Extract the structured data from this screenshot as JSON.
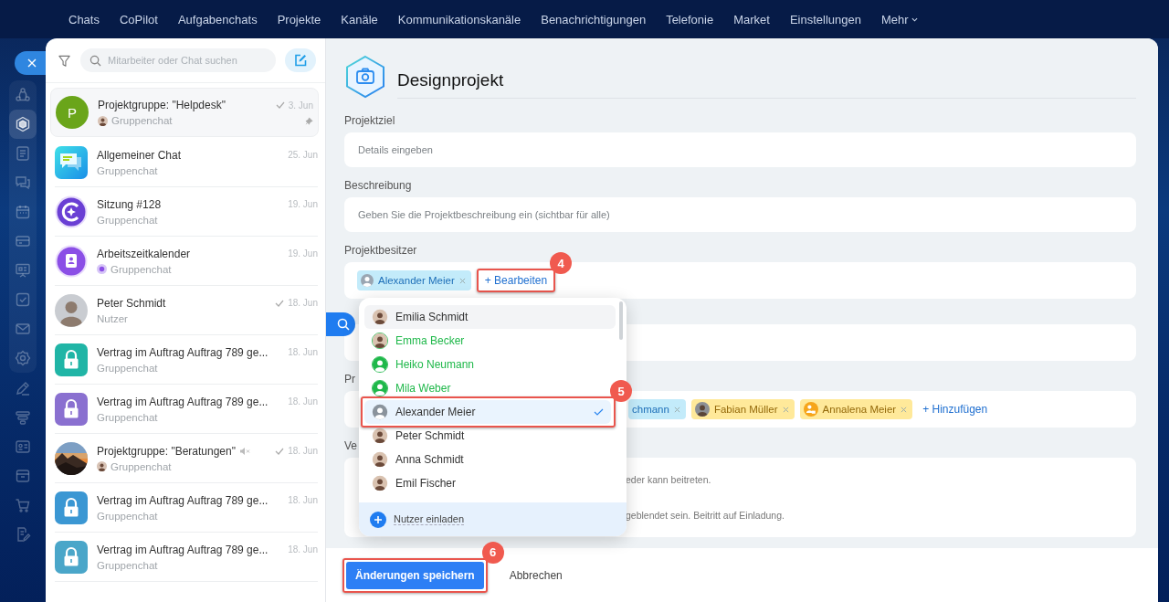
{
  "top_nav": [
    {
      "label": "Chats",
      "menu": false
    },
    {
      "label": "CoPilot",
      "menu": false
    },
    {
      "label": "Aufgabenchats",
      "menu": false
    },
    {
      "label": "Projekte",
      "menu": false
    },
    {
      "label": "Kanäle",
      "menu": false
    },
    {
      "label": "Kommunikationskanäle",
      "menu": false
    },
    {
      "label": "Benachrichtigungen",
      "menu": false
    },
    {
      "label": "Telefonie",
      "menu": false
    },
    {
      "label": "Market",
      "menu": false
    },
    {
      "label": "Einstellungen",
      "menu": false
    },
    {
      "label": "Mehr",
      "menu": true
    }
  ],
  "rail": {
    "pinned": [
      {
        "selected": false
      },
      {
        "selected": true
      },
      {
        "selected": false
      },
      {
        "selected": false
      },
      {
        "selected": false
      },
      {
        "selected": false
      },
      {
        "selected": false
      },
      {
        "selected": false
      },
      {
        "selected": false
      },
      {
        "selected": false
      }
    ],
    "more": [
      {
        "selected": false
      },
      {
        "selected": false
      },
      {
        "selected": false
      },
      {
        "selected": false
      },
      {
        "selected": false
      },
      {
        "selected": false
      }
    ]
  },
  "chat_list": {
    "search": {
      "placeholder": "Mitarbeiter oder Chat suchen"
    },
    "chats": [
      {
        "name": "Projektgruppe: \"Helpdesk\"",
        "subtitle": "Gruppenchat",
        "date": "3. Jun",
        "read": true,
        "pinned": true,
        "muted": false,
        "selected": true,
        "author_avatar": true,
        "badge": false,
        "avatar": {
          "kind": "letter",
          "text": "P",
          "color": "#6aa51a"
        }
      },
      {
        "name": "Allgemeiner Chat",
        "subtitle": "Gruppenchat",
        "date": "25. Jun",
        "read": false,
        "pinned": false,
        "muted": false,
        "selected": false,
        "author_avatar": false,
        "badge": false,
        "avatar": {
          "kind": "chat"
        }
      },
      {
        "name": "Sitzung #128",
        "subtitle": "Gruppenchat",
        "date": "19. Jun",
        "read": false,
        "pinned": false,
        "muted": false,
        "selected": false,
        "author_avatar": false,
        "badge": false,
        "avatar": {
          "kind": "copilot"
        }
      },
      {
        "name": "Arbeitszeitkalender",
        "subtitle": "Gruppenchat",
        "date": "19. Jun",
        "read": false,
        "pinned": false,
        "muted": false,
        "selected": false,
        "author_avatar": false,
        "badge": true,
        "avatar": {
          "kind": "calendar"
        }
      },
      {
        "name": "Peter Schmidt",
        "subtitle": "Nutzer",
        "date": "18. Jun",
        "read": true,
        "pinned": false,
        "muted": false,
        "selected": false,
        "author_avatar": false,
        "badge": false,
        "avatar": {
          "kind": "person"
        }
      },
      {
        "name": "Vertrag im Auftrag Auftrag 789 ge...",
        "subtitle": "Gruppenchat",
        "date": "18. Jun",
        "read": false,
        "pinned": false,
        "muted": false,
        "selected": false,
        "author_avatar": false,
        "badge": false,
        "avatar": {
          "kind": "lock",
          "color": "#20b5a6"
        }
      },
      {
        "name": "Vertrag im Auftrag Auftrag 789 ge...",
        "subtitle": "Gruppenchat",
        "date": "18. Jun",
        "read": false,
        "pinned": false,
        "muted": false,
        "selected": false,
        "author_avatar": false,
        "badge": false,
        "avatar": {
          "kind": "lock",
          "color": "#8a70d0"
        }
      },
      {
        "name": "Projektgruppe: \"Beratungen\"",
        "subtitle": "Gruppenchat",
        "date": "18. Jun",
        "read": true,
        "pinned": false,
        "muted": true,
        "selected": false,
        "author_avatar": true,
        "badge": false
      },
      {
        "name": "Vertrag im Auftrag Auftrag 789 ge...",
        "subtitle": "Gruppenchat",
        "date": "18. Jun",
        "read": false,
        "pinned": false,
        "muted": false,
        "selected": false,
        "author_avatar": false,
        "badge": false,
        "avatar": {
          "kind": "lock",
          "color": "#3b97d3"
        }
      },
      {
        "name": "Vertrag im Auftrag Auftrag 789 ge...",
        "subtitle": "Gruppenchat",
        "date": "18. Jun",
        "read": false,
        "pinned": false,
        "muted": false,
        "selected": false,
        "author_avatar": false,
        "badge": false,
        "avatar": {
          "kind": "lock",
          "color": "#4aa6c9"
        }
      }
    ]
  },
  "project": {
    "title": "Designprojekt"
  },
  "fields": [
    {
      "label": "Projektziel",
      "placeholder": "Details eingeben"
    },
    {
      "label": "Beschreibung",
      "placeholder": "Geben Sie die Projektbeschreibung ein (sichtbar für alle)"
    }
  ],
  "owner": {
    "label": "Projektbesitzer",
    "tags": [
      {
        "name": "Alexander Meier",
        "kind": "employee",
        "avatar": {
          "kind": "default"
        }
      }
    ],
    "edit": {
      "label": "+ Bearbeiten",
      "callout": "4"
    }
  },
  "participants": {
    "label": "Pr",
    "tags": [
      {
        "name": "chmann",
        "kind": "employee"
      },
      {
        "name": "Fabian Müller",
        "kind": "guest"
      },
      {
        "name": "Annalena Meier",
        "kind": "guest",
        "avatar": {
          "kind": "guest"
        }
      }
    ],
    "add": "+ Hinzufügen"
  },
  "visibility": {
    "label": "Ve",
    "lines": [
      "eder kann beitreten.",
      "geblendet sein. Beitritt auf Einladung."
    ]
  },
  "picker": {
    "items": [
      {
        "name": "Emilia Schmidt",
        "kind": "employee",
        "hovered": true,
        "selected": false
      },
      {
        "name": "Emma Becker",
        "kind": "extranet",
        "hovered": false,
        "selected": false
      },
      {
        "name": "Heiko Neumann",
        "kind": "extranet",
        "avatar": {
          "kind": "default"
        },
        "hovered": false,
        "selected": false
      },
      {
        "name": "Mila Weber",
        "kind": "extranet",
        "avatar": {
          "kind": "default"
        },
        "hovered": false,
        "selected": false
      },
      {
        "name": "Alexander Meier",
        "kind": "employee",
        "avatar": {
          "kind": "default"
        },
        "hovered": false,
        "selected": true,
        "callout": "5"
      },
      {
        "name": "Peter Schmidt",
        "kind": "employee",
        "hovered": false,
        "selected": false
      },
      {
        "name": "Anna Schmidt",
        "kind": "employee",
        "hovered": false,
        "selected": false
      },
      {
        "name": "Emil Fischer",
        "kind": "employee",
        "hovered": false,
        "selected": false
      }
    ],
    "invite": "Nutzer einladen"
  },
  "footer": {
    "save": {
      "label": "Änderungen speichern",
      "callout": "6"
    },
    "cancel": "Abbrechen"
  }
}
